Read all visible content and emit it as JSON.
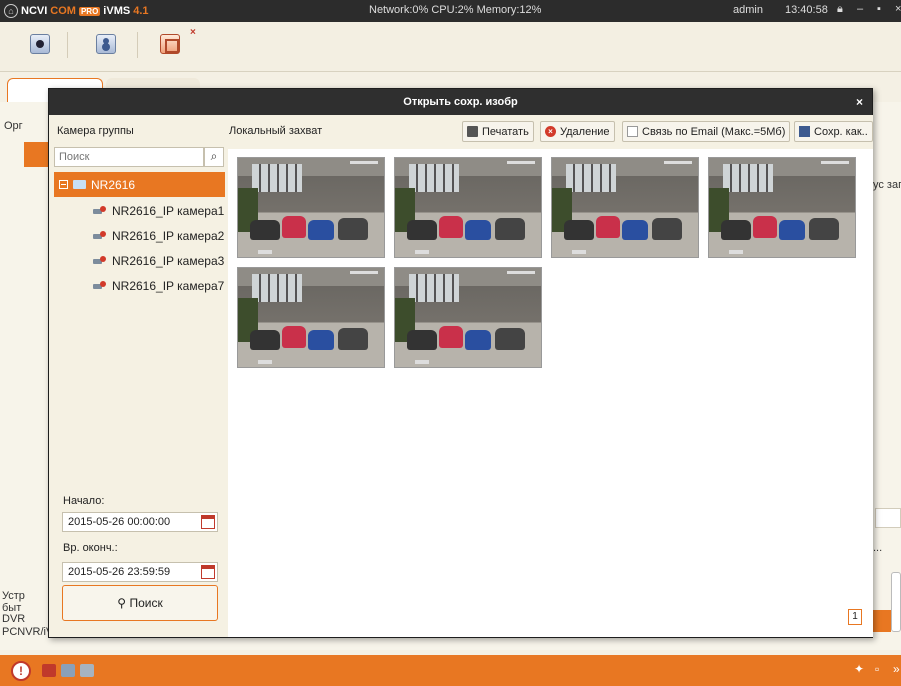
{
  "app": {
    "brand_a": "NCVI",
    "brand_b": "COM",
    "brand_pro": "PRO",
    "brand_name": "iVMS",
    "brand_ver": "4.1",
    "stats": "Network:0% CPU:2% Memory:12%",
    "user": "admin",
    "clock": "13:40:58",
    "lock_icon": "lock-icon",
    "min_label": "–",
    "max_label": "▪",
    "close_label": "×"
  },
  "toolbar": {
    "close_mark": "×"
  },
  "background": {
    "left_frag_1": "Орг",
    "left_frag_2": "",
    "right_frag": "ус заг",
    "bottom_frag_1": "Устр",
    "bottom_frag_2": "быт",
    "bottom_frag_3": "DVR",
    "bottom_line": "PCNVR/iVMS Кодирование сервера",
    "ellipsis": "...",
    "pipe": "|"
  },
  "dialog": {
    "title": "Открыть сохр. изобр",
    "close_label": "×",
    "sidebar": {
      "heading": "Камера группы",
      "search_placeholder": "Поиск",
      "root_label": "NR2616",
      "cameras": [
        "NR2616_IP камера1",
        "NR2616_IP камера2",
        "NR2616_IP камера3",
        "NR2616_IP камера7"
      ],
      "start_label": "Начало:",
      "start_value": "2015-05-26 00:00:00",
      "end_label": "Вр. оконч.:",
      "end_value": "2015-05-26 23:59:59",
      "search_button": "Поиск"
    },
    "main": {
      "title": "Локальный захват",
      "print_button": "Печатать",
      "delete_button": "Удаление",
      "email_button": "Связь по Email (Макс.=5Мб)",
      "save_button": "Сохр. как..",
      "page_number": "1"
    }
  },
  "colors": {
    "accent": "#e87722",
    "titlebar": "#2c2c2c",
    "panel": "#f5f1e3"
  }
}
